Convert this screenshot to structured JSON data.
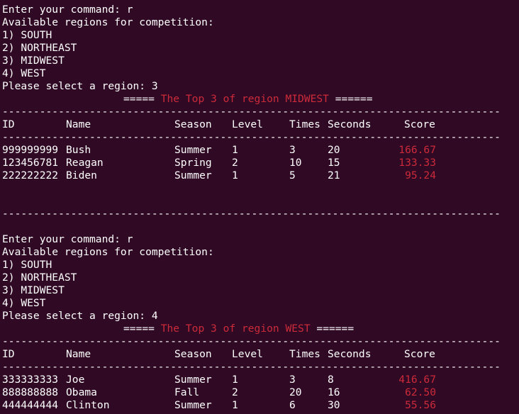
{
  "blocks": [
    {
      "command_prompt": "Enter your command: r",
      "regions_header": "Available regions for competition:",
      "regions": [
        "1) SOUTH",
        "2) NORTHEAST",
        "3) MIDWEST",
        "4) WEST"
      ],
      "select_prompt": "Please select a region: 3",
      "banner_left": "=====",
      "banner_text": "The Top 3 of region MIDWEST",
      "banner_right": "======",
      "headers": {
        "id": "ID",
        "name": "Name",
        "season": "Season",
        "level": "Level",
        "times": "Times",
        "seconds": "Seconds",
        "score": "Score"
      },
      "rows": [
        {
          "id": "999999999",
          "name": "Bush",
          "season": "Summer",
          "level": "1",
          "times": "3",
          "seconds": "20",
          "score": "166.67"
        },
        {
          "id": "123456781",
          "name": "Reagan",
          "season": "Spring",
          "level": "2",
          "times": "10",
          "seconds": "15",
          "score": "133.33"
        },
        {
          "id": "222222222",
          "name": "Biden",
          "season": "Summer",
          "level": "1",
          "times": "5",
          "seconds": "21",
          "score": "95.24"
        }
      ]
    },
    {
      "command_prompt": "Enter your command: r",
      "regions_header": "Available regions for competition:",
      "regions": [
        "1) SOUTH",
        "2) NORTHEAST",
        "3) MIDWEST",
        "4) WEST"
      ],
      "select_prompt": "Please select a region: 4",
      "banner_left": "=====",
      "banner_text": "The Top 3 of region WEST",
      "banner_right": "======",
      "headers": {
        "id": "ID",
        "name": "Name",
        "season": "Season",
        "level": "Level",
        "times": "Times",
        "seconds": "Seconds",
        "score": "Score"
      },
      "rows": [
        {
          "id": "333333333",
          "name": "Joe",
          "season": "Summer",
          "level": "1",
          "times": "3",
          "seconds": "8",
          "score": "416.67"
        },
        {
          "id": "888888888",
          "name": "Obama",
          "season": "Fall",
          "level": "2",
          "times": "20",
          "seconds": "16",
          "score": "62.50"
        },
        {
          "id": "444444444",
          "name": "Clinton",
          "season": "Summer",
          "level": "1",
          "times": "6",
          "seconds": "30",
          "score": "55.56"
        }
      ]
    }
  ],
  "separator": "--------------------------------------------------------------------------------",
  "colors": {
    "background": "#300a24",
    "text": "#ffffff",
    "highlight": "#cc2a3a"
  }
}
